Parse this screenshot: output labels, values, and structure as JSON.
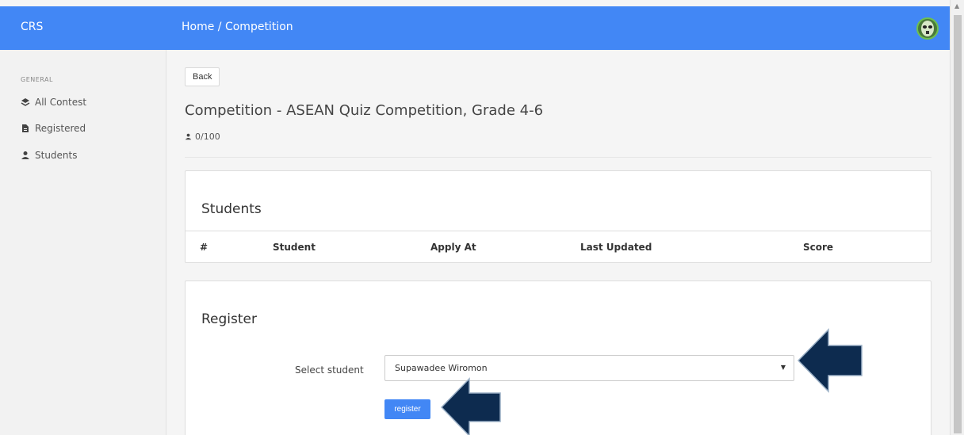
{
  "header": {
    "brand": "CRS",
    "breadcrumb": "Home / Competition"
  },
  "sidebar": {
    "section": "GENERAL",
    "items": [
      {
        "label": "All Contest",
        "icon": "layers-icon"
      },
      {
        "label": "Registered",
        "icon": "file-icon"
      },
      {
        "label": "Students",
        "icon": "user-icon"
      }
    ]
  },
  "main": {
    "back_label": "Back",
    "title": "Competition - ASEAN Quiz Competition, Grade 4-6",
    "count": "0/100",
    "students": {
      "heading": "Students",
      "columns": [
        "#",
        "Student",
        "Apply At",
        "Last Updated",
        "Score"
      ]
    },
    "register": {
      "heading": "Register",
      "select_label": "Select student",
      "selected_value": "Supawadee Wiromon",
      "button_label": "register"
    }
  },
  "colors": {
    "accent": "#4287f5",
    "arrow": "#0d2b4f"
  }
}
